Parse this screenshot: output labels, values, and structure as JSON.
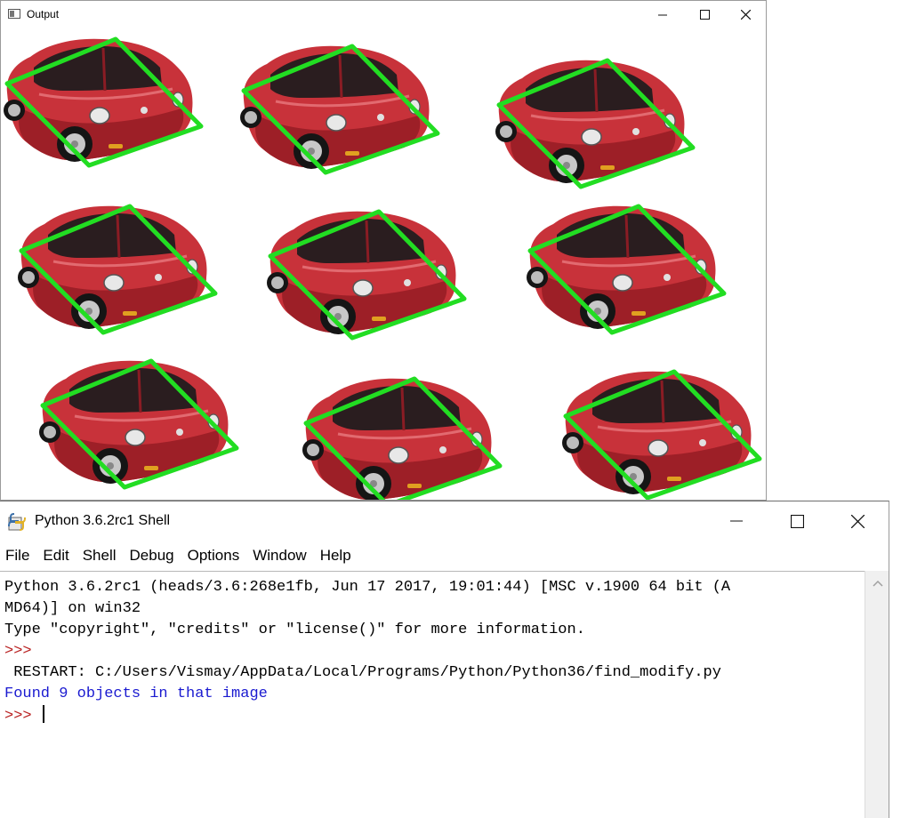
{
  "output_window": {
    "title": "Output",
    "image": {
      "car_count": 9,
      "car_color": "#c8323a",
      "box_color": "#22dd22"
    }
  },
  "shell_window": {
    "title": "Python 3.6.2rc1 Shell",
    "menu": [
      "File",
      "Edit",
      "Shell",
      "Debug",
      "Options",
      "Window",
      "Help"
    ],
    "lines": {
      "banner_1": "Python 3.6.2rc1 (heads/3.6:268e1fb, Jun 17 2017, 19:01:44) [MSC v.1900 64 bit (A",
      "banner_2": "MD64)] on win32",
      "banner_3": "Type \"copyright\", \"credits\" or \"license()\" for more information.",
      "prompt_1": ">>> ",
      "restart": " RESTART: C:/Users/Vismay/AppData/Local/Programs/Python/Python36/find_modify.py",
      "result": "Found 9 objects in that image",
      "prompt_2": ">>> "
    },
    "colors": {
      "prompt": "#b81e1e",
      "output": "#1a1ad0"
    }
  }
}
